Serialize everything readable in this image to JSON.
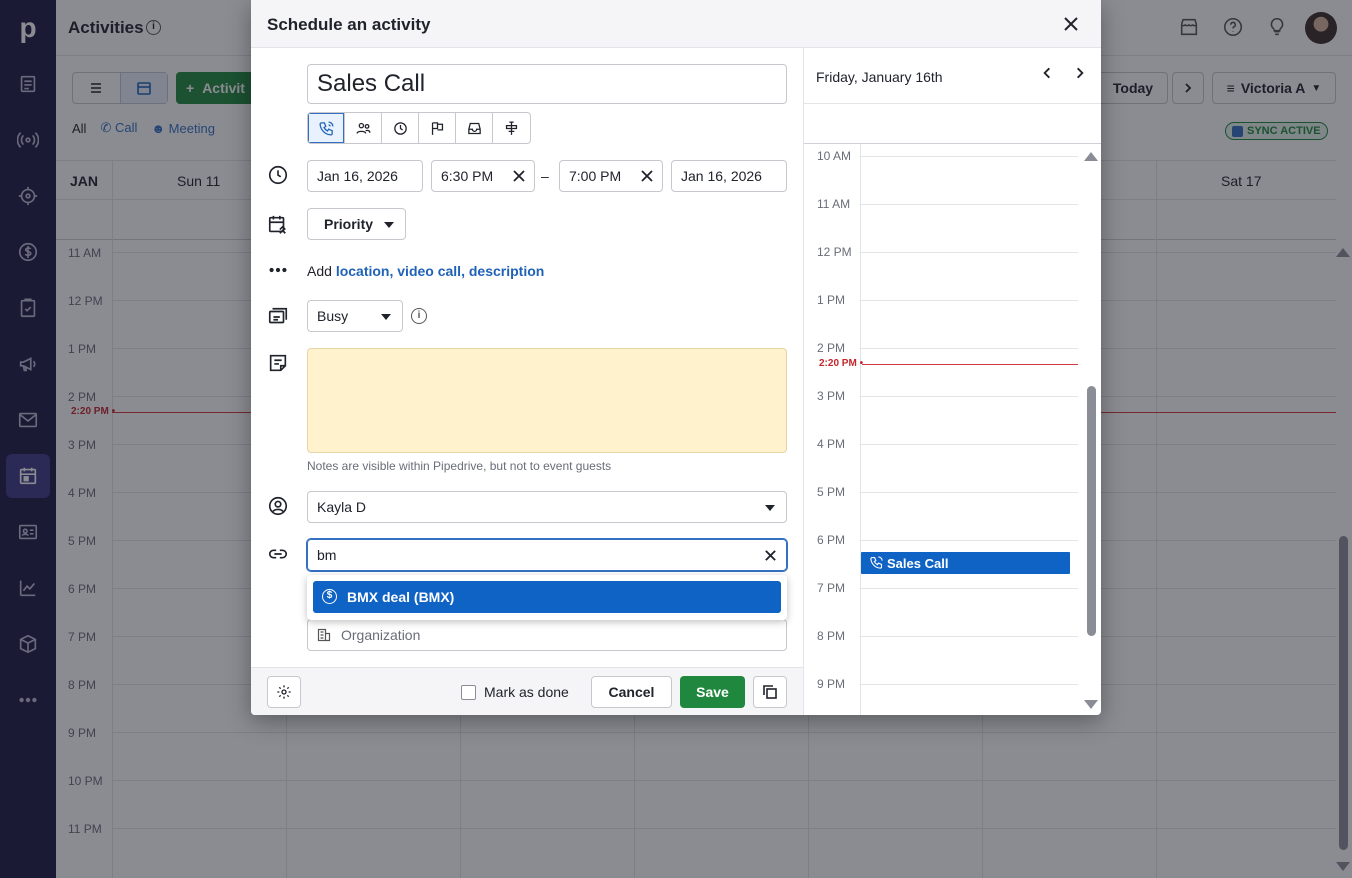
{
  "colors": {
    "accent": "#0e63c4",
    "save": "#20883e",
    "now_line": "#d4383d",
    "notes_bg": "#fff2cc",
    "rail": "#1f1a45"
  },
  "rail": {
    "logo": "p",
    "items": [
      "leads-icon",
      "activity-radar-icon",
      "target-icon",
      "deals-dollar-icon",
      "tasks-icon",
      "campaigns-megaphone-icon",
      "mail-icon",
      "calendar-icon",
      "contacts-icon",
      "insights-chart-icon",
      "products-box-icon",
      "more-icon"
    ]
  },
  "background": {
    "title": "Activities",
    "add_activity": "Activit",
    "filters": {
      "all": "All",
      "call": "Call",
      "meeting": "Meeting"
    },
    "today": "Today",
    "user": "Victoria A",
    "sync": "SYNC ACTIVE",
    "month": "JAN",
    "day_first": "Sun 11",
    "day_last": "Sat 17",
    "hours": [
      "11 AM",
      "12 PM",
      "1 PM",
      "2 PM",
      "3 PM",
      "4 PM",
      "5 PM",
      "6 PM",
      "7 PM",
      "8 PM",
      "9 PM",
      "10 PM",
      "11 PM"
    ],
    "now": "2:20 PM"
  },
  "modal": {
    "title": "Schedule an activity",
    "subject": "Sales Call",
    "activity_types": [
      "call",
      "meeting",
      "deadline",
      "flag",
      "inbox",
      "lunch"
    ],
    "start_date": "Jan 16, 2026",
    "start_time": "6:30 PM",
    "dash": "–",
    "end_time": "7:00 PM",
    "end_date": "Jan 16, 2026",
    "priority": "Priority",
    "add_prefix": "Add",
    "add_links": {
      "location": "location,",
      "video": "video call,",
      "description": "description"
    },
    "busy": "Busy",
    "notes_hint": "Notes are visible within Pipedrive, but not to event guests",
    "assignee": "Kayla D",
    "link_query": "bm",
    "suggestion": "BMX deal (BMX)",
    "organization_placeholder": "Organization",
    "mark_done": "Mark as done",
    "cancel": "Cancel",
    "save": "Save"
  },
  "day_view": {
    "date": "Friday, January 16th",
    "hours": [
      "10 AM",
      "11 AM",
      "12 PM",
      "1 PM",
      "2 PM",
      "3 PM",
      "4 PM",
      "5 PM",
      "6 PM",
      "7 PM",
      "8 PM",
      "9 PM"
    ],
    "now": "2:20 PM",
    "event": "Sales Call"
  }
}
